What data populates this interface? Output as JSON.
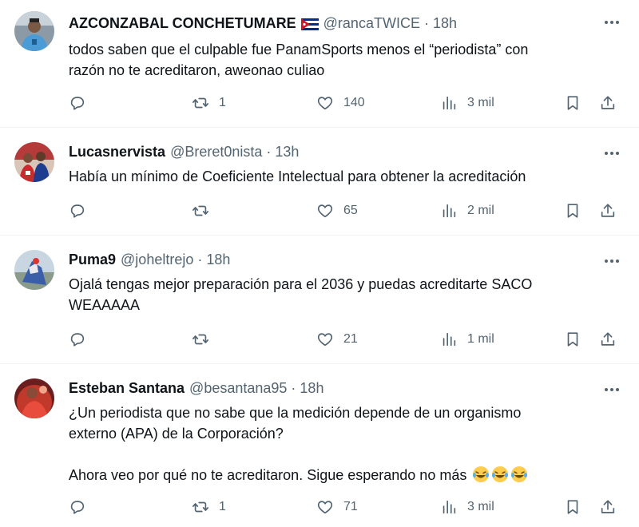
{
  "tweets": [
    {
      "name": "AZCONZABAL CONCHETUMARE",
      "handle": "@rancaTWICE",
      "separator": "·",
      "time": "18h",
      "lines": [
        "todos saben que el culpable fue PanamSports menos el “periodista” con",
        "razón no te acreditaron, aweonao culiao"
      ],
      "replies": "",
      "reposts": "1",
      "likes": "140",
      "views": "3 mil"
    },
    {
      "name": "Lucasnervista",
      "handle": "@Breret0nista",
      "separator": "·",
      "time": "13h",
      "lines": [
        "Había un mínimo de Coeficiente Intelectual para obtener la acreditación"
      ],
      "replies": "",
      "reposts": "",
      "likes": "65",
      "views": "2 mil"
    },
    {
      "name": "Puma9",
      "handle": "@joheltrejo",
      "separator": "·",
      "time": "18h",
      "lines": [
        "Ojalá tengas mejor preparación para el 2036 y puedas acreditarte SACO",
        "WEAAAAA"
      ],
      "replies": "",
      "reposts": "",
      "likes": "21",
      "views": "1 mil"
    },
    {
      "name": "Esteban Santana",
      "handle": "@besantana95",
      "separator": "·",
      "time": "18h",
      "lines": [
        "¿Un periodista que no sabe que la medición depende de un organismo",
        "externo (APA) de la Corporación?",
        "",
        "Ahora veo por qué no te acreditaron. Sigue esperando no más"
      ],
      "replies": "",
      "reposts": "1",
      "likes": "71",
      "views": "3 mil"
    }
  ],
  "icons": {
    "reply": "reply-icon",
    "repost": "repost-icon",
    "like": "heart-icon",
    "views": "views-icon",
    "bookmark": "bookmark-icon",
    "share": "share-icon",
    "more": "more-icon",
    "flag": "cuba-flag-icon",
    "emoji": "laughing-tears-emoji"
  },
  "colors": {
    "text": "#0f1419",
    "secondary": "#536471",
    "divider": "#eff3f4",
    "flag_blue": "#002a8f",
    "flag_red": "#cf142b"
  }
}
